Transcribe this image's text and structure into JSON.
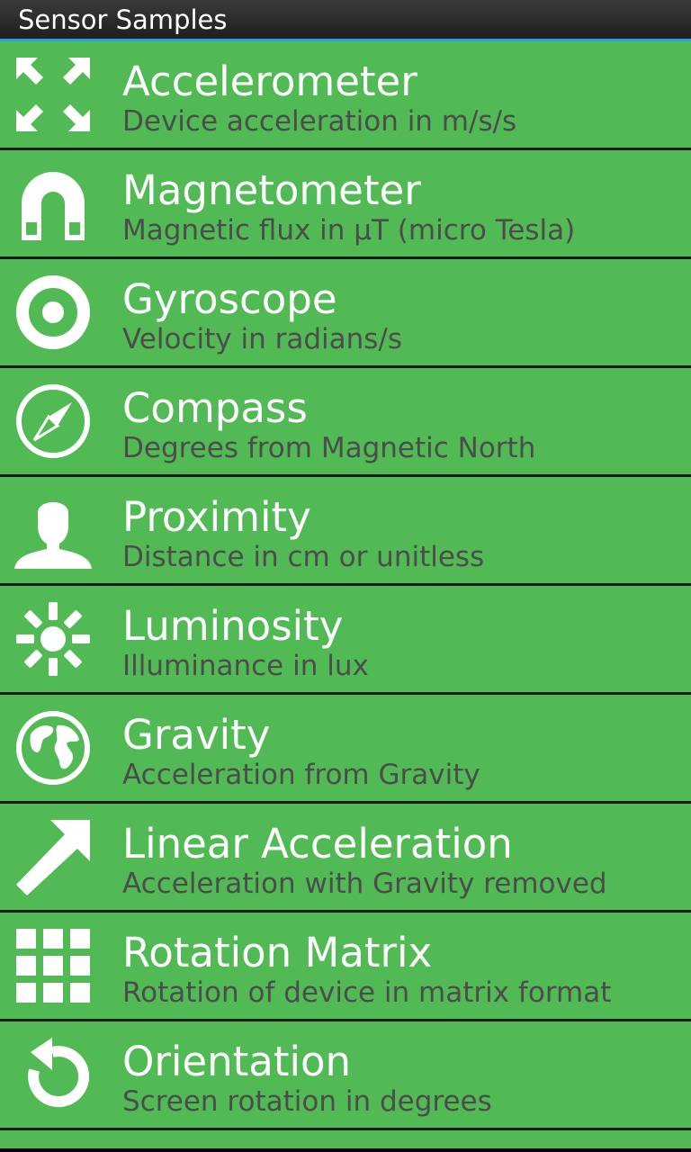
{
  "app": {
    "title": "Sensor Samples",
    "accent_color": "#1fa6d8",
    "item_color": "#52ba55"
  },
  "sensors": [
    {
      "icon": "expand-arrows-icon",
      "label": "Accelerometer",
      "sub": "Device acceleration in m/s/s"
    },
    {
      "icon": "magnet-icon",
      "label": "Magnetometer",
      "sub": "Magnetic flux in µT (micro Tesla)"
    },
    {
      "icon": "target-icon",
      "label": "Gyroscope",
      "sub": "Velocity in radians/s"
    },
    {
      "icon": "compass-icon",
      "label": "Compass",
      "sub": "Degrees from Magnetic North"
    },
    {
      "icon": "person-icon",
      "label": "Proximity",
      "sub": "Distance in cm or unitless"
    },
    {
      "icon": "sun-icon",
      "label": "Luminosity",
      "sub": "Illuminance in lux"
    },
    {
      "icon": "globe-icon",
      "label": "Gravity",
      "sub": "Acceleration from Gravity"
    },
    {
      "icon": "arrow-up-right-icon",
      "label": "Linear Acceleration",
      "sub": "Acceleration with Gravity removed"
    },
    {
      "icon": "grid-icon",
      "label": "Rotation Matrix",
      "sub": "Rotation of device in matrix format"
    },
    {
      "icon": "rotate-icon",
      "label": "Orientation",
      "sub": "Screen rotation in degrees"
    }
  ]
}
